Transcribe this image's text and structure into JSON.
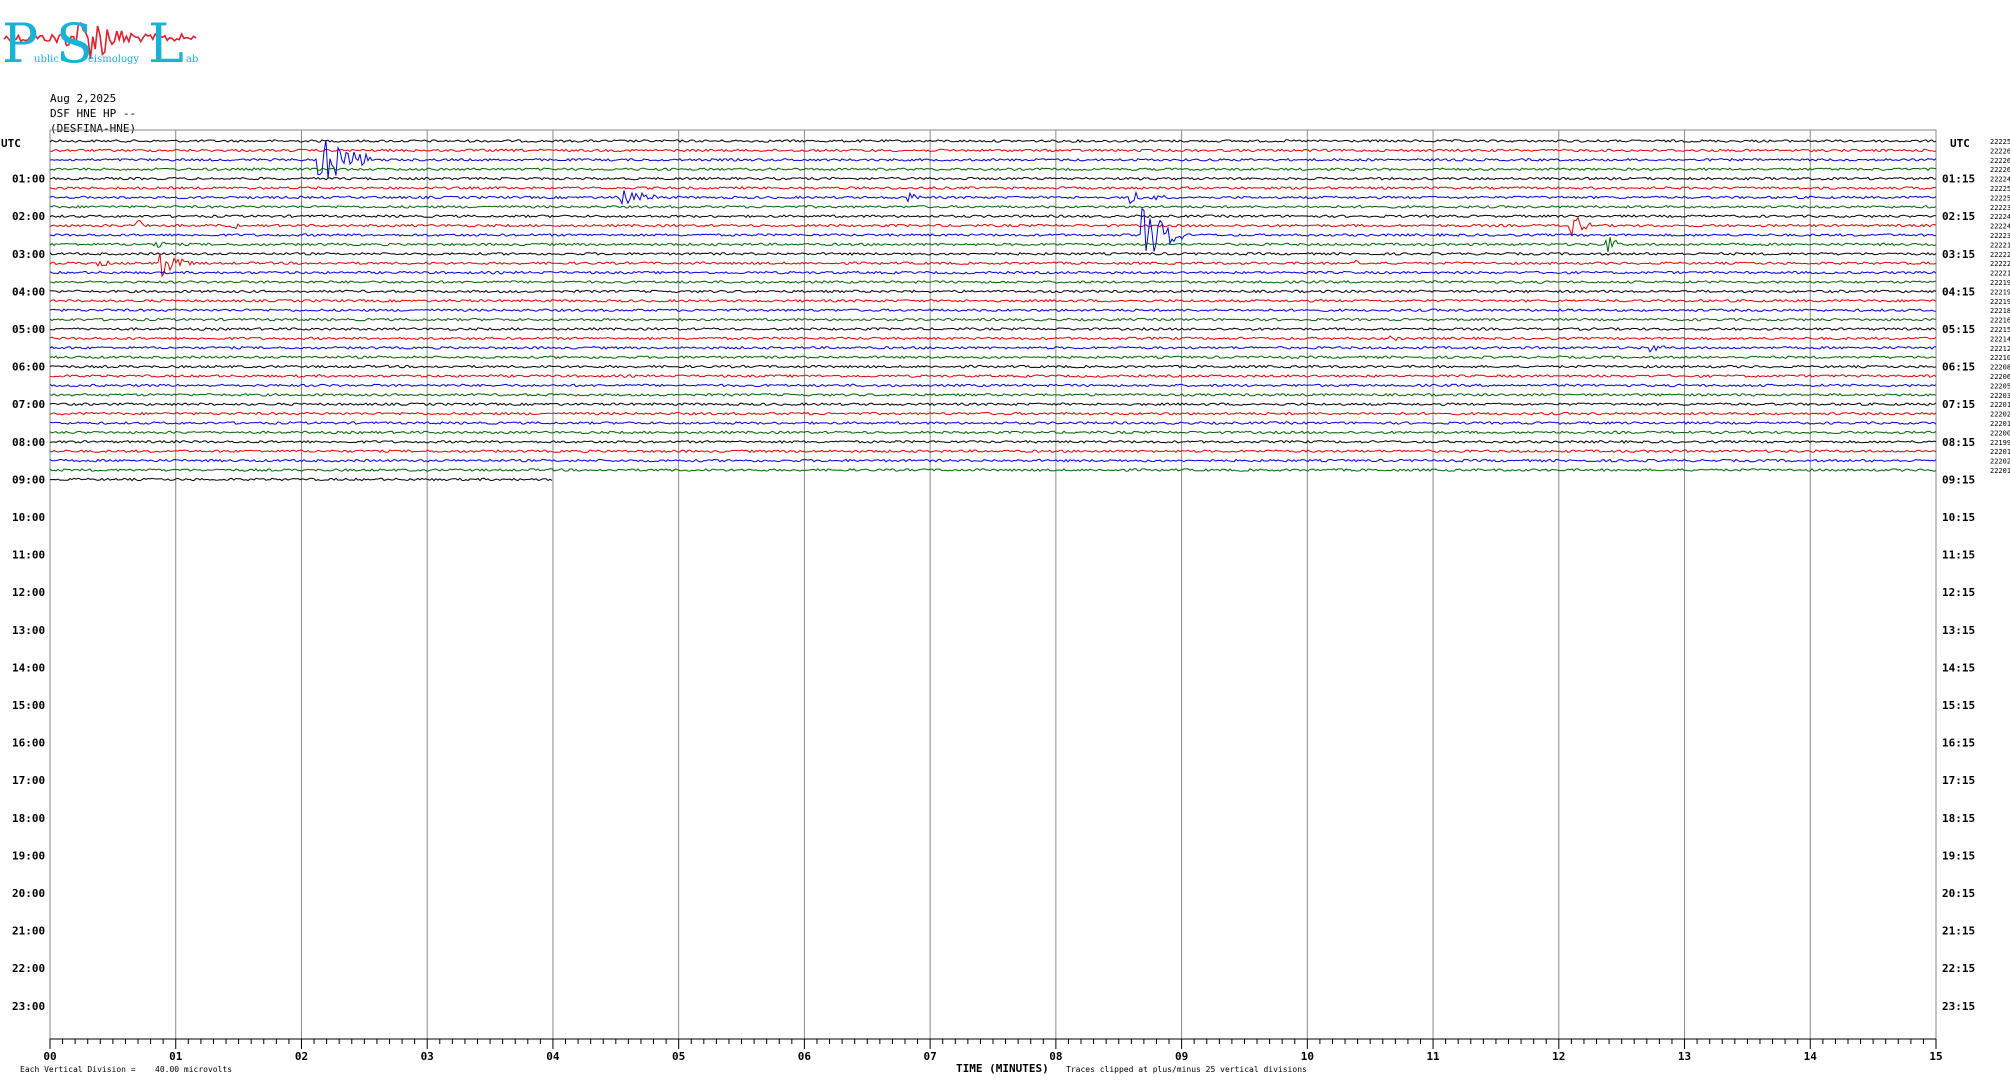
{
  "logo": {
    "letters": [
      "P",
      "S",
      "L"
    ],
    "small_words": [
      "ublic",
      "eismology",
      "ab"
    ],
    "colors": {
      "letters": "#17b3d6",
      "squiggle": "#e0202a"
    }
  },
  "header": {
    "date": "Aug 2,2025",
    "channel": "DSF HNE HP --",
    "station": "(DESFINA-HNE)"
  },
  "footer": {
    "scale_note_prefix": "Each Vertical Division =",
    "scale_note_value": "40.00 microvolts",
    "xlabel": "TIME (MINUTES)",
    "clip_note": "Traces clipped at plus/minus 25 vertical divisions"
  },
  "chart_data": {
    "type": "line",
    "title": "",
    "xlabel": "TIME (MINUTES)",
    "ylabel": "UTC",
    "y2label": "UTC",
    "xlim": [
      0,
      15
    ],
    "x_ticks": [
      "00",
      "01",
      "02",
      "03",
      "04",
      "05",
      "06",
      "07",
      "08",
      "09",
      "10",
      "11",
      "12",
      "13",
      "14",
      "15"
    ],
    "left_hour_labels": [
      "",
      "01:00",
      "02:00",
      "03:00",
      "04:00",
      "05:00",
      "06:00",
      "07:00",
      "08:00",
      "09:00",
      "10:00",
      "11:00",
      "12:00",
      "13:00",
      "14:00",
      "15:00",
      "16:00",
      "17:00",
      "18:00",
      "19:00",
      "20:00",
      "21:00",
      "22:00",
      "23:00"
    ],
    "right_hour_labels": [
      "",
      "01:15",
      "02:15",
      "03:15",
      "04:15",
      "05:15",
      "06:15",
      "07:15",
      "08:15",
      "09:15",
      "10:15",
      "11:15",
      "12:15",
      "13:15",
      "14:15",
      "15:15",
      "16:15",
      "17:15",
      "18:15",
      "19:15",
      "20:15",
      "21:15",
      "22:15",
      "23:15"
    ],
    "trace_colors": [
      "#000000",
      "#e00000",
      "#0000e0",
      "#006400"
    ],
    "trace_count": 36,
    "last_trace_end_minute": 4,
    "rms_values": [
      "22225",
      "22226",
      "22226",
      "22226",
      "22224",
      "22225",
      "22225",
      "22223",
      "22224",
      "22224",
      "22223",
      "22221",
      "22222",
      "22222",
      "22221",
      "22219",
      "22219",
      "22219",
      "22218",
      "22216",
      "22215",
      "22214",
      "22212",
      "22210",
      "22208",
      "22206",
      "22205",
      "22203",
      "22201",
      "22202",
      "22201",
      "22200",
      "22199",
      "22201",
      "22202",
      "22201"
    ],
    "events": [
      {
        "trace": 2,
        "minute": 2.15,
        "amplitude": 3.0,
        "duration_min": 0.4
      },
      {
        "trace": 6,
        "minute": 4.55,
        "amplitude": 1.2,
        "duration_min": 0.3
      },
      {
        "trace": 6,
        "minute": 6.85,
        "amplitude": 0.5,
        "duration_min": 0.1
      },
      {
        "trace": 6,
        "minute": 8.6,
        "amplitude": 0.6,
        "duration_min": 0.3
      },
      {
        "trace": 9,
        "minute": 1.4,
        "amplitude": 0.5,
        "duration_min": 0.2
      },
      {
        "trace": 9,
        "minute": 0.7,
        "amplitude": 0.6,
        "duration_min": 0.15
      },
      {
        "trace": 10,
        "minute": 8.7,
        "amplitude": 3.0,
        "duration_min": 0.35
      },
      {
        "trace": 9,
        "minute": 12.1,
        "amplitude": 1.5,
        "duration_min": 0.15
      },
      {
        "trace": 11,
        "minute": 12.4,
        "amplitude": 1.0,
        "duration_min": 0.1
      },
      {
        "trace": 11,
        "minute": 0.85,
        "amplitude": 0.5,
        "duration_min": 0.1
      },
      {
        "trace": 13,
        "minute": 0.9,
        "amplitude": 1.6,
        "duration_min": 0.25
      },
      {
        "trace": 13,
        "minute": 0.4,
        "amplitude": 0.4,
        "duration_min": 0.2
      },
      {
        "trace": 13,
        "minute": 10.35,
        "amplitude": 0.6,
        "duration_min": 0.1
      },
      {
        "trace": 21,
        "minute": 10.65,
        "amplitude": 0.3,
        "duration_min": 0.1
      },
      {
        "trace": 22,
        "minute": 12.75,
        "amplitude": 0.5,
        "duration_min": 0.1
      }
    ]
  }
}
